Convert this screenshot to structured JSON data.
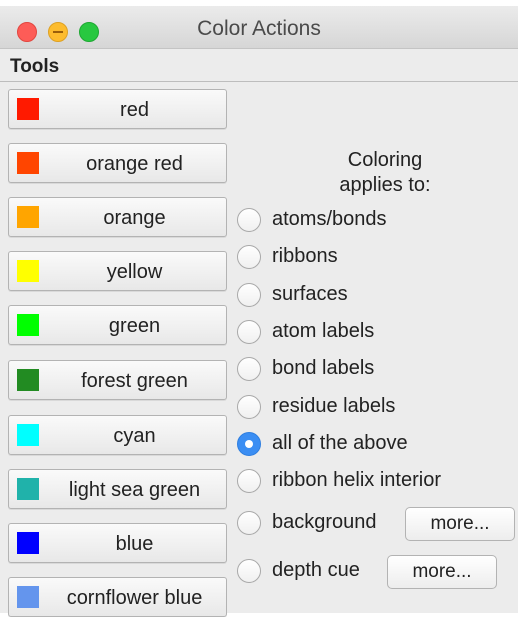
{
  "window": {
    "title": "Color Actions"
  },
  "toolbar": {
    "label": "Tools"
  },
  "color_buttons": [
    {
      "label": "red",
      "color": "#ff1a00"
    },
    {
      "label": "orange red",
      "color": "#ff4500"
    },
    {
      "label": "orange",
      "color": "#ffa500"
    },
    {
      "label": "yellow",
      "color": "#ffff00"
    },
    {
      "label": "green",
      "color": "#00ff00"
    },
    {
      "label": "forest green",
      "color": "#228b22"
    },
    {
      "label": "cyan",
      "color": "#00ffff"
    },
    {
      "label": "light sea green",
      "color": "#20b2aa"
    },
    {
      "label": "blue",
      "color": "#0000ff"
    },
    {
      "label": "cornflower blue",
      "color": "#6495ed"
    }
  ],
  "target": {
    "heading_line1": "Coloring",
    "heading_line2": "applies to:",
    "options": [
      {
        "label": "atoms/bonds",
        "checked": false
      },
      {
        "label": "ribbons",
        "checked": false
      },
      {
        "label": "surfaces",
        "checked": false
      },
      {
        "label": "atom labels",
        "checked": false
      },
      {
        "label": "bond labels",
        "checked": false
      },
      {
        "label": "residue labels",
        "checked": false
      },
      {
        "label": "all of the above",
        "checked": true
      },
      {
        "label": "ribbon helix interior",
        "checked": false
      },
      {
        "label": "background",
        "checked": false
      },
      {
        "label": "depth cue",
        "checked": false
      }
    ],
    "more_label": "more..."
  }
}
